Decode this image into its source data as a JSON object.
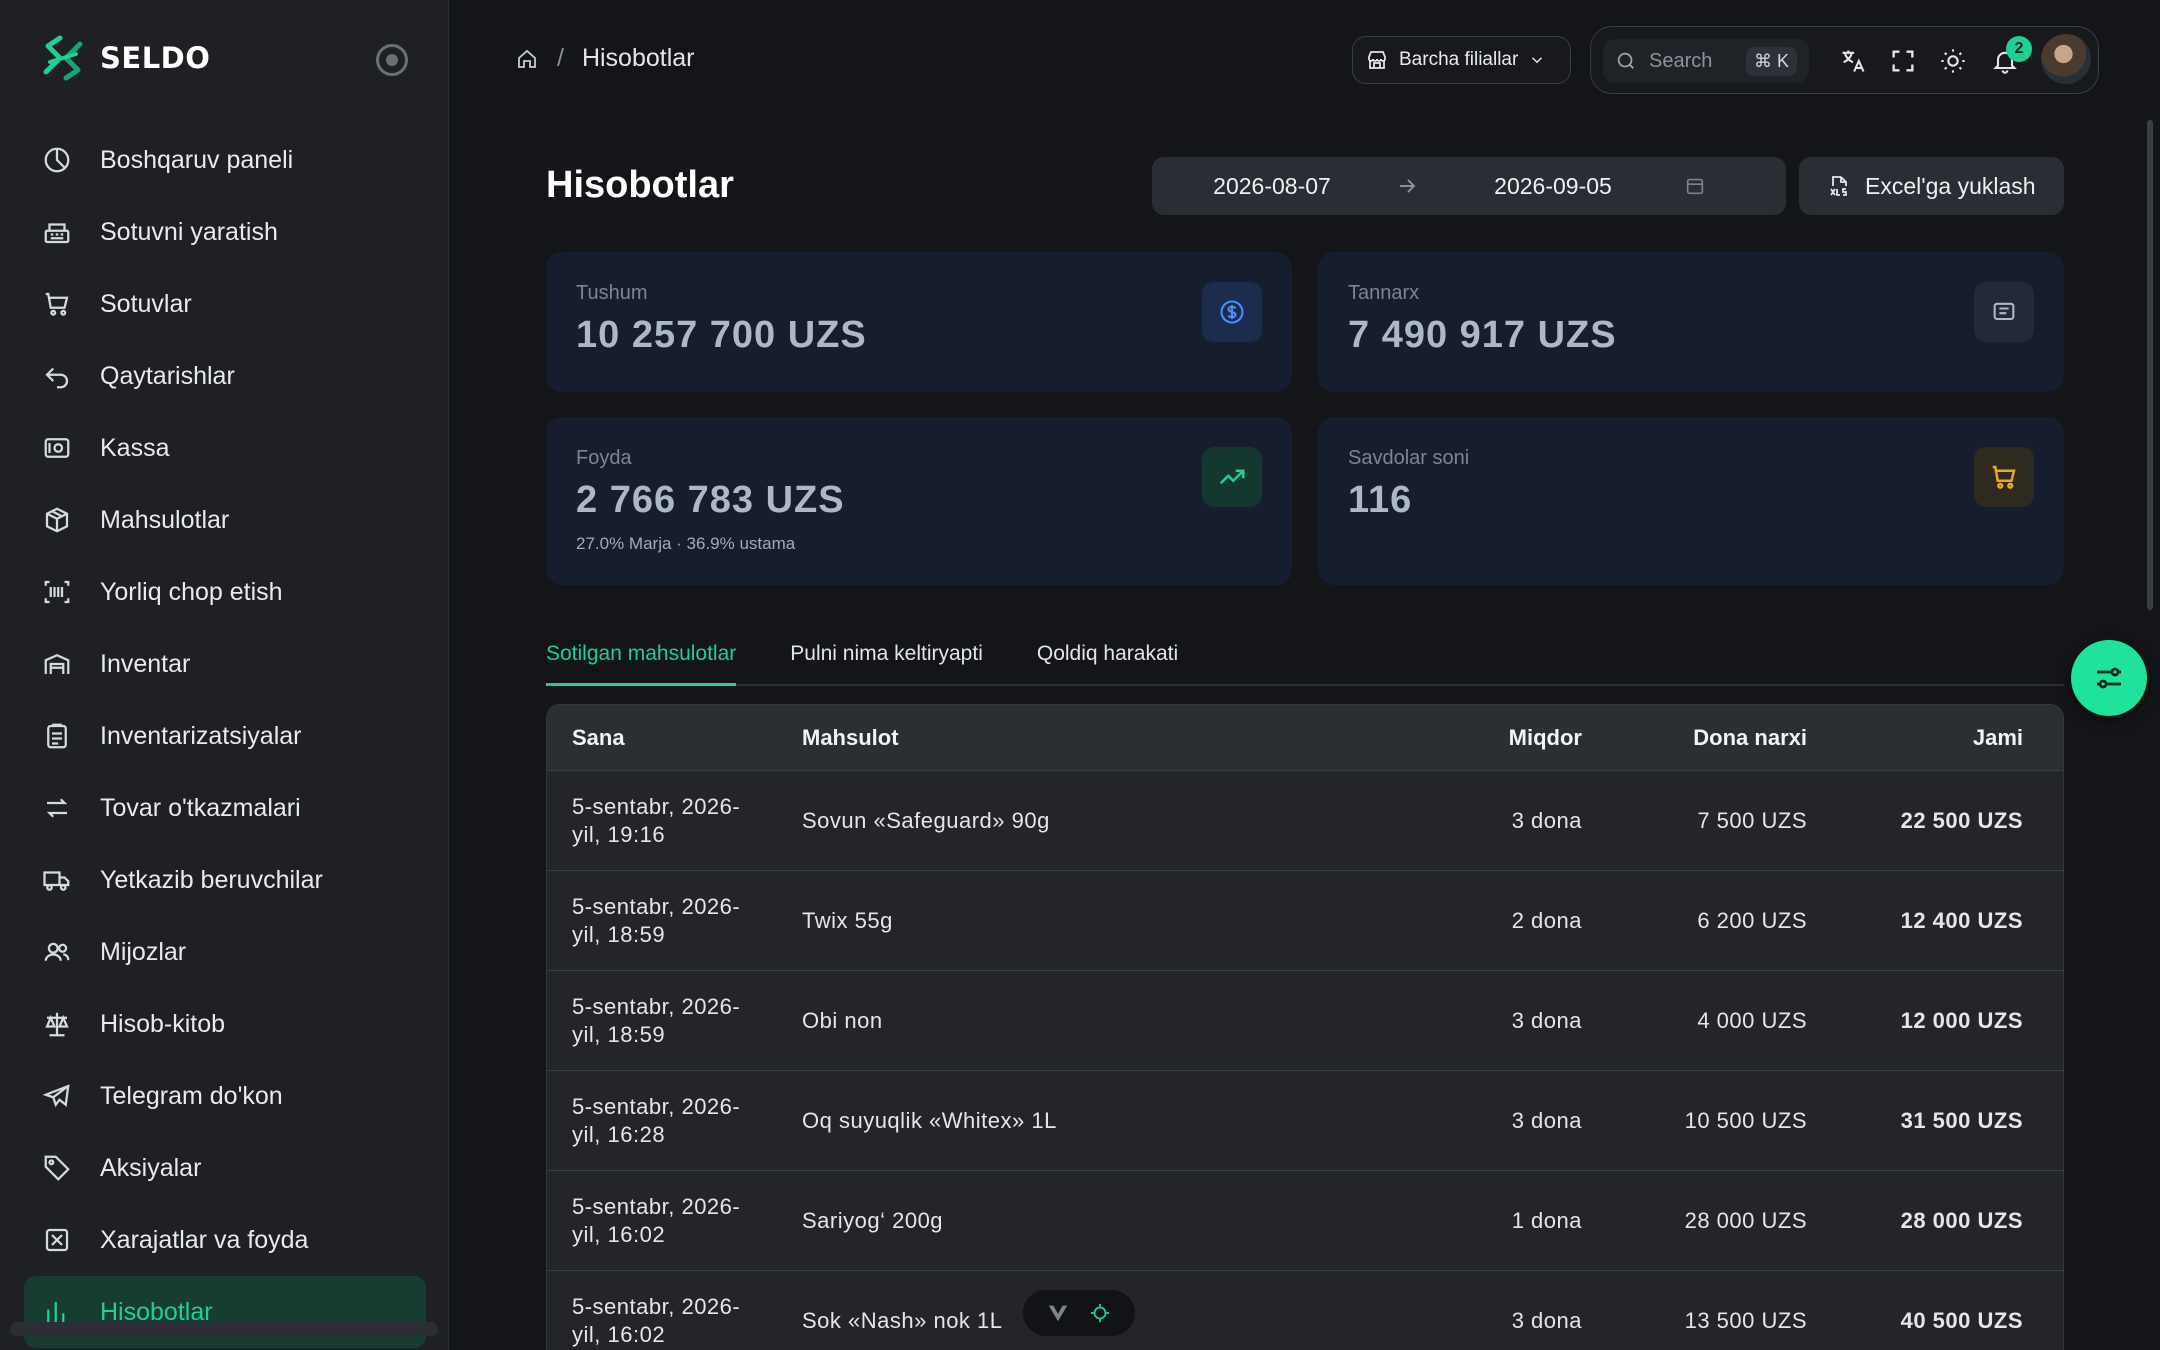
{
  "brand": {
    "name": "SELDO"
  },
  "sidebar": {
    "items": [
      {
        "label": "Boshqaruv paneli",
        "icon": "dashboard-icon"
      },
      {
        "label": "Sotuvni yaratish",
        "icon": "cash-register-icon"
      },
      {
        "label": "Sotuvlar",
        "icon": "cart-icon"
      },
      {
        "label": "Qaytarishlar",
        "icon": "return-icon"
      },
      {
        "label": "Kassa",
        "icon": "cash-box-icon"
      },
      {
        "label": "Mahsulotlar",
        "icon": "box-icon"
      },
      {
        "label": "Yorliq chop etish",
        "icon": "barcode-icon"
      },
      {
        "label": "Inventar",
        "icon": "warehouse-icon"
      },
      {
        "label": "Inventarizatsiyalar",
        "icon": "clipboard-icon"
      },
      {
        "label": "Tovar o'tkazmalari",
        "icon": "transfer-icon"
      },
      {
        "label": "Yetkazib beruvchilar",
        "icon": "truck-icon"
      },
      {
        "label": "Mijozlar",
        "icon": "users-icon"
      },
      {
        "label": "Hisob-kitob",
        "icon": "scale-icon"
      },
      {
        "label": "Telegram do'kon",
        "icon": "telegram-icon"
      },
      {
        "label": "Aksiyalar",
        "icon": "tag-icon"
      },
      {
        "label": "Xarajatlar va foyda",
        "icon": "expense-icon"
      },
      {
        "label": "Hisobotlar",
        "icon": "report-icon",
        "active": true
      }
    ]
  },
  "header": {
    "breadcrumb_current": "Hisobotlar",
    "branch_label": "Barcha filiallar",
    "search_placeholder": "Search",
    "search_shortcut": "⌘ K",
    "notification_count": "2"
  },
  "page": {
    "title": "Hisobotlar",
    "date_from": "2026-08-07",
    "date_to": "2026-09-05",
    "excel_label": "Excel'ga yuklash"
  },
  "stats": {
    "revenue": {
      "label": "Tushum",
      "value": "10 257 700 UZS"
    },
    "cost": {
      "label": "Tannarx",
      "value": "7 490 917 UZS"
    },
    "profit": {
      "label": "Foyda",
      "value": "2 766 783 UZS",
      "sub": "27.0% Marja · 36.9% ustama"
    },
    "deals": {
      "label": "Savdolar soni",
      "value": "116"
    }
  },
  "tabs": [
    "Sotilgan mahsulotlar",
    "Pulni nima keltiryapti",
    "Qoldiq harakati"
  ],
  "table": {
    "headers": [
      "Sana",
      "Mahsulot",
      "Miqdor",
      "Dona narxi",
      "Jami"
    ],
    "rows": [
      {
        "date1": "5-sentabr, 2026-",
        "date2": "yil, 19:16",
        "product": "Sovun «Safeguard» 90g",
        "qty": "3 dona",
        "price": "7 500 UZS",
        "total": "22 500 UZS"
      },
      {
        "date1": "5-sentabr, 2026-",
        "date2": "yil, 18:59",
        "product": "Twix 55g",
        "qty": "2 dona",
        "price": "6 200 UZS",
        "total": "12 400 UZS"
      },
      {
        "date1": "5-sentabr, 2026-",
        "date2": "yil, 18:59",
        "product": "Obi non",
        "qty": "3 dona",
        "price": "4 000 UZS",
        "total": "12 000 UZS"
      },
      {
        "date1": "5-sentabr, 2026-",
        "date2": "yil, 16:28",
        "product": "Oq suyuqlik «Whitex» 1L",
        "qty": "3 dona",
        "price": "10 500 UZS",
        "total": "31 500 UZS"
      },
      {
        "date1": "5-sentabr, 2026-",
        "date2": "yil, 16:02",
        "product": "Sariyog‘ 200g",
        "qty": "1 dona",
        "price": "28 000 UZS",
        "total": "28 000 UZS"
      },
      {
        "date1": "5-sentabr, 2026-",
        "date2": "yil, 16:02",
        "product": "Sok «Nash» nok 1L",
        "qty": "3 dona",
        "price": "13 500 UZS",
        "total": "40 500 UZS"
      }
    ]
  },
  "colors": {
    "accent": "#1fcf93",
    "card_bg": "#151d2e",
    "sidebar_bg": "#1e2024"
  }
}
